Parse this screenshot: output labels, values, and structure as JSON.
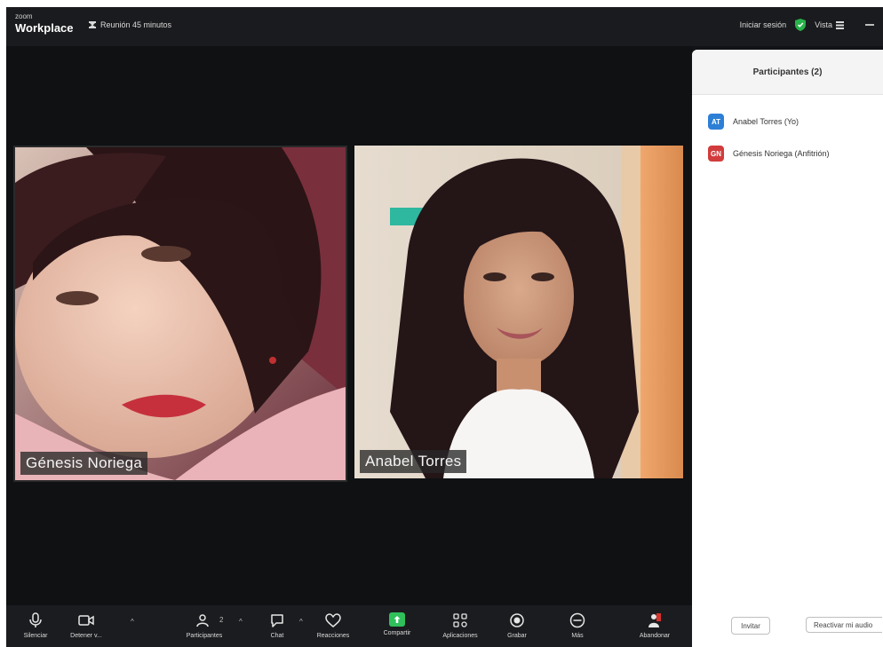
{
  "topbar": {
    "brand_small": "zoom",
    "brand_big": "Workplace",
    "meeting_timer": "Reunión 45 minutos",
    "sign_in": "Iniciar sesión",
    "view_label": "Vista"
  },
  "videos": [
    {
      "name": "Génesis Noriega"
    },
    {
      "name": "Anabel Torres"
    }
  ],
  "panel": {
    "title": "Participantes (2)",
    "participants": [
      {
        "initials": "AT",
        "name": "Anabel Torres (Yo)",
        "color": "#2d7fd6"
      },
      {
        "initials": "GN",
        "name": "Génesis Noriega (Anfitrión)",
        "color": "#d23c3c"
      }
    ],
    "invite_button": "Invitar",
    "unmute_button": "Reactivar mi audio"
  },
  "toolbar": {
    "mute": "Silenciar",
    "video": "Detener v...",
    "participants": "Participantes",
    "participants_count": "2",
    "chat": "Chat",
    "reactions": "Reacciones",
    "share": "Compartir",
    "apps": "Aplicaciones",
    "record": "Grabar",
    "more": "Más",
    "leave": "Abandonar",
    "share_color": "#2fbf5b"
  }
}
